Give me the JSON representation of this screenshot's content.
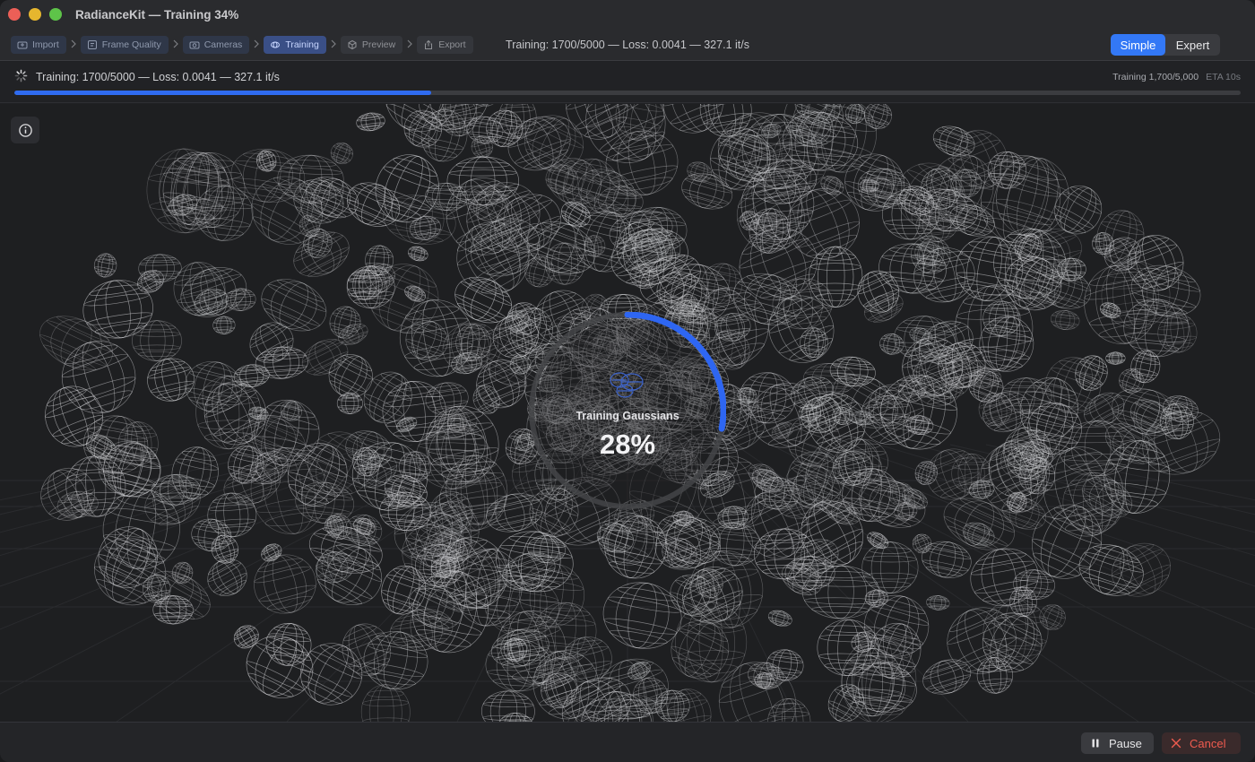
{
  "window": {
    "title": "RadianceKit — Training 34%"
  },
  "breadcrumb": [
    {
      "label": "Import",
      "icon": "import-icon",
      "state": "done"
    },
    {
      "label": "Frame Quality",
      "icon": "frame-quality-icon",
      "state": "done"
    },
    {
      "label": "Cameras",
      "icon": "camera-icon",
      "state": "done"
    },
    {
      "label": "Training",
      "icon": "training-icon",
      "state": "active"
    },
    {
      "label": "Preview",
      "icon": "cube-icon",
      "state": "pending"
    },
    {
      "label": "Export",
      "icon": "share-icon",
      "state": "pending"
    }
  ],
  "toolbar": {
    "status": "Training: 1700/5000 — Loss: 0.0041 — 327.1 it/s",
    "mode_simple": "Simple",
    "mode_expert": "Expert",
    "active_mode": "Simple"
  },
  "status_strip": {
    "text": "Training: 1700/5000 — Loss: 0.0041 — 327.1 it/s",
    "right_label": "Training 1,700/5,000",
    "eta": "ETA 10s",
    "progress_fraction": 0.34
  },
  "overlay": {
    "label": "Training Gaussians",
    "percent_text": "28%",
    "progress_fraction": 0.28
  },
  "footer": {
    "pause_label": "Pause",
    "cancel_label": "Cancel"
  },
  "colors": {
    "accent": "#3378f6",
    "progress": "#2f6bf0",
    "cancel": "#ef5b4f",
    "background": "#1e1f21"
  }
}
